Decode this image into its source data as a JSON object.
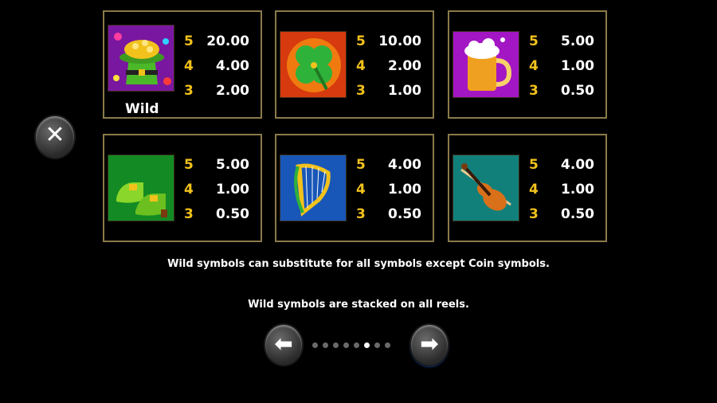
{
  "paytable": [
    {
      "symbol": "pot-of-gold-hat-icon",
      "label": "Wild",
      "bg": "#9c1fc6",
      "pays": [
        {
          "count": "5",
          "value": "20.00"
        },
        {
          "count": "4",
          "value": "4.00"
        },
        {
          "count": "3",
          "value": "2.00"
        }
      ]
    },
    {
      "symbol": "four-leaf-clover-icon",
      "bg": "#d63a0e",
      "pays": [
        {
          "count": "5",
          "value": "10.00"
        },
        {
          "count": "4",
          "value": "2.00"
        },
        {
          "count": "3",
          "value": "1.00"
        }
      ]
    },
    {
      "symbol": "beer-mug-icon",
      "bg": "#a316c4",
      "pays": [
        {
          "count": "5",
          "value": "5.00"
        },
        {
          "count": "4",
          "value": "1.00"
        },
        {
          "count": "3",
          "value": "0.50"
        }
      ]
    },
    {
      "symbol": "leprechaun-shoes-icon",
      "bg": "#138a24",
      "pays": [
        {
          "count": "5",
          "value": "5.00"
        },
        {
          "count": "4",
          "value": "1.00"
        },
        {
          "count": "3",
          "value": "0.50"
        }
      ]
    },
    {
      "symbol": "harp-icon",
      "bg": "#1856b8",
      "pays": [
        {
          "count": "5",
          "value": "4.00"
        },
        {
          "count": "4",
          "value": "1.00"
        },
        {
          "count": "3",
          "value": "0.50"
        }
      ]
    },
    {
      "symbol": "violin-icon",
      "bg": "#12807a",
      "pays": [
        {
          "count": "5",
          "value": "4.00"
        },
        {
          "count": "4",
          "value": "1.00"
        },
        {
          "count": "3",
          "value": "0.50"
        }
      ]
    }
  ],
  "info": {
    "line1": "Wild symbols can substitute for all symbols except Coin symbols.",
    "line2": "Wild symbols are stacked on all reels."
  },
  "nav": {
    "close_icon": "close-icon",
    "prev_icon": "arrow-left-icon",
    "next_icon": "arrow-right-icon",
    "close_glyph": "✕",
    "prev_glyph": "⬅",
    "next_glyph": "➡",
    "page_count": 8,
    "current_page": 6
  },
  "colors": {
    "count": "#f2c21c",
    "value": "#ffffff",
    "border": "#8a7a4a"
  }
}
